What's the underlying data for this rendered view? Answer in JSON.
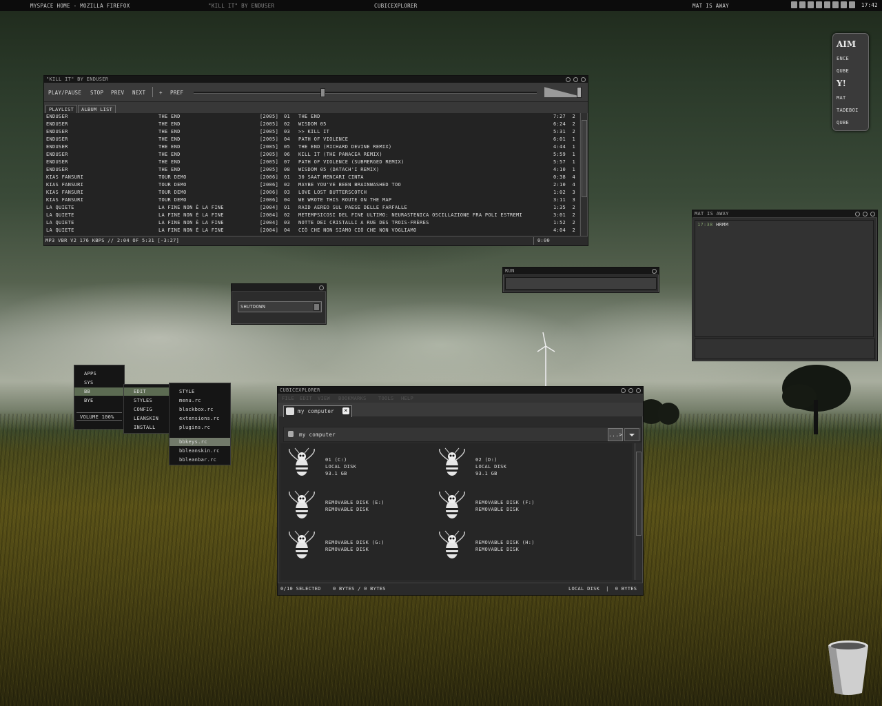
{
  "topbar": {
    "win1": "Myspace Home - Mozilla Firefox",
    "win2": "\"Kill it\" by Enduser",
    "win3": "CubicExplorer",
    "win4": "Mat is away",
    "clock": "17:42"
  },
  "player": {
    "title": "\"Kill it\" by Enduser",
    "buttons": [
      "Play/Pause",
      "Stop",
      "Prev",
      "Next",
      "+",
      "Pref"
    ],
    "tabs": [
      "Playlist",
      "Album list"
    ],
    "rows": [
      [
        "Enduser",
        "The End",
        "[2005]",
        "01",
        "The End",
        "7:27",
        "2"
      ],
      [
        "Enduser",
        "The End",
        "[2005]",
        "02",
        "Wisdom 05",
        "6:24",
        "2"
      ],
      [
        "Enduser",
        "The End",
        "[2005]",
        "03",
        ">> Kill it",
        "5:31",
        "2"
      ],
      [
        "Enduser",
        "The End",
        "[2005]",
        "04",
        "Path of Violence",
        "6:01",
        "1"
      ],
      [
        "Enduser",
        "The End",
        "[2005]",
        "05",
        "The End (Richard Devine remix)",
        "4:44",
        "1"
      ],
      [
        "Enduser",
        "The End",
        "[2005]",
        "06",
        "Kill It (The Panacea remix)",
        "5:59",
        "1"
      ],
      [
        "Enduser",
        "The End",
        "[2005]",
        "07",
        "Path of Violence (Submerged remix)",
        "5:57",
        "1"
      ],
      [
        "Enduser",
        "The End",
        "[2005]",
        "08",
        "Wisdom 05 (Datach'i remix)",
        "4:10",
        "1"
      ],
      [
        "Kias Fansuri",
        "Tour Demo",
        "[2006]",
        "01",
        "30 Saat Mencari Cinta",
        "0:38",
        "4"
      ],
      [
        "Kias Fansuri",
        "Tour Demo",
        "[2006]",
        "02",
        "Maybe You've Been Brainwashed Too",
        "2:10",
        "4"
      ],
      [
        "Kias Fansuri",
        "Tour Demo",
        "[2006]",
        "03",
        "Love Lost Butterscotch",
        "1:02",
        "3"
      ],
      [
        "Kias Fansuri",
        "Tour Demo",
        "[2006]",
        "04",
        "We Wrote This Route On The Map",
        "3:11",
        "3"
      ],
      [
        "La Quiete",
        "La Fine Non È La Fine",
        "[2004]",
        "01",
        "Raid Aereo Sul Paese Delle Farfalle",
        "1:35",
        "2"
      ],
      [
        "La Quiete",
        "La Fine Non È La Fine",
        "[2004]",
        "02",
        "Metempsicosi Del Fine Ultimo: Neurastenica Oscillazione Fra Poli Estremi",
        "3:01",
        "2"
      ],
      [
        "La Quiete",
        "La Fine Non È La Fine",
        "[2004]",
        "03",
        "Notte Dei Cristalli A Rue Des Trois-Frères",
        "1:52",
        "2"
      ],
      [
        "La Quiete",
        "La Fine Non È La Fine",
        "[2004]",
        "04",
        "Ciò Che Non Siamo Ciò Che Non Vogliamo",
        "4:04",
        "2"
      ]
    ],
    "status": "MP3 VBR V2 176 kbps // 2:04 of 5:31 [-3:27]",
    "status_time": "0:00",
    "progress": 0.375
  },
  "shutdown": {
    "value": "Shutdown"
  },
  "run": {
    "title": "Run"
  },
  "im": {
    "title": "Mat is away",
    "time": "17:38",
    "message": "hrmm"
  },
  "dock": [
    "AIM",
    "ence",
    "qube",
    "Y!",
    "Mat",
    "tadeboi",
    "qube"
  ],
  "menu1": {
    "items": [
      "Apps",
      "Sys",
      "BB",
      "Bye"
    ],
    "volume": "Volume 100%"
  },
  "menu2": {
    "items": [
      "Edit",
      "Styles",
      "Config",
      "LeanSkin",
      "Install"
    ]
  },
  "menu3": {
    "items": [
      "style",
      "menu.rc",
      "blackbox.rc",
      "extensions.rc",
      "plugins.rc"
    ],
    "items2": [
      "bbkeys.rc",
      "bbleanskin.rc",
      "bbleanbar.rc"
    ]
  },
  "explorer": {
    "title": "CubicExplorer",
    "menu": [
      "File",
      "Edit",
      "View",
      "Bookmarks",
      "Tools",
      "Help"
    ],
    "tab": "My Computer",
    "path": "My Computer",
    "go": "...>",
    "drives": [
      {
        "name": "01 (C:)",
        "type": "Local Disk",
        "size": "93.1 GB"
      },
      {
        "name": "02 (D:)",
        "type": "Local Disk",
        "size": "93.1 GB"
      },
      {
        "name": "Removable Disk (E:)",
        "type": "Removable Disk",
        "size": ""
      },
      {
        "name": "Removable Disk (F:)",
        "type": "Removable Disk",
        "size": ""
      },
      {
        "name": "Removable Disk (G:)",
        "type": "Removable Disk",
        "size": ""
      },
      {
        "name": "Removable Disk (H:)",
        "type": "Removable Disk",
        "size": ""
      }
    ],
    "status_sel": "0/10 Selected",
    "status_bytes": "0 bytes / 0 bytes",
    "status_right": "Local Disk  |  0 bytes"
  }
}
